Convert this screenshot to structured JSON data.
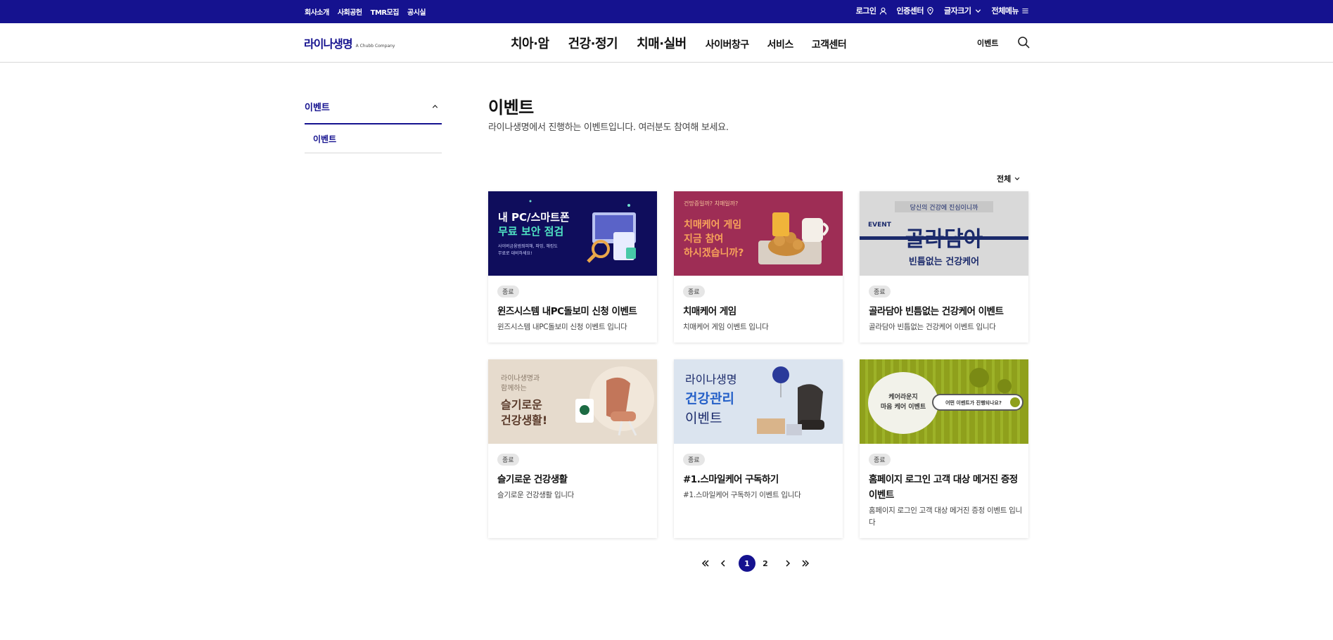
{
  "topbar": {
    "left_links": [
      "회사소개",
      "사회공헌",
      "TMR모집",
      "공시실"
    ],
    "login": "로그인",
    "auth_center": "인증센터",
    "font_size": "글자크기",
    "all_menu": "전체메뉴"
  },
  "header": {
    "logo_text": "라이나생명",
    "logo_sub": "A Chubb Company",
    "gnb_big": [
      "치아·암",
      "건강·정기",
      "치매·실버"
    ],
    "gnb_small": [
      "사이버창구",
      "서비스",
      "고객센터"
    ],
    "event_link": "이벤트"
  },
  "sidebar": {
    "title": "이벤트",
    "items": [
      "이벤트"
    ]
  },
  "main": {
    "title": "이벤트",
    "description": "라이나생명에서 진행하는 이벤트입니다. 여러분도 참여해 보세요.",
    "filter_label": "전체"
  },
  "cards": [
    {
      "status": "종료",
      "title": "윈즈시스템 내PC돌보미 신청 이벤트",
      "desc": "윈즈시스템 내PC돌보미 신청 이벤트 입니다",
      "image_text": [
        "내 PC/스마트폰",
        "무료 보안 점검",
        "사이버금융범죄피해, 파밍, 해킹도",
        "무료로 대비하세요!"
      ]
    },
    {
      "status": "종료",
      "title": "치매케어 게임",
      "desc": "치매케어 게임 이벤트 입니다",
      "image_text": [
        "건망증일까? 치매일까?",
        "치매케어 게임",
        "지금 참여",
        "하시겠습니까?"
      ]
    },
    {
      "status": "종료",
      "title": "골라담아 빈틈없는 건강케어 이벤트",
      "desc": "골라담아 빈틈없는 건강케어 이벤트 입니다",
      "image_text": [
        "당신의 건강에 진심이니까",
        "EVENT",
        "골라담아",
        "빈틈없는 건강케어"
      ]
    },
    {
      "status": "종료",
      "title": "슬기로운 건강생활",
      "desc": "슬기로운 건강생활 입니다",
      "image_text": [
        "라이나생명과",
        "함께하는",
        "슬기로운",
        "건강생활!"
      ]
    },
    {
      "status": "종료",
      "title": "#1.스마일케어 구독하기",
      "desc": "#1.스마일케어 구독하기 이벤트 입니다",
      "image_text": [
        "라이나생명",
        "건강관리",
        "이벤트"
      ]
    },
    {
      "status": "종료",
      "title": "홈페이지 로그인 고객 대상 메거진 증정 이벤트",
      "desc": "홈페이지 로그인 고객 대상 메거진 증정 이벤트 입니다",
      "image_text": [
        "케어라운지",
        "마음 케어 이벤트",
        "어떤 이벤트가 진행되나요?"
      ]
    }
  ],
  "pagination": {
    "pages": [
      "1",
      "2"
    ],
    "current": "1"
  },
  "colors": {
    "brand": "#15128f",
    "border": "#d8d8d8",
    "badge_bg": "#e6e6e6"
  }
}
